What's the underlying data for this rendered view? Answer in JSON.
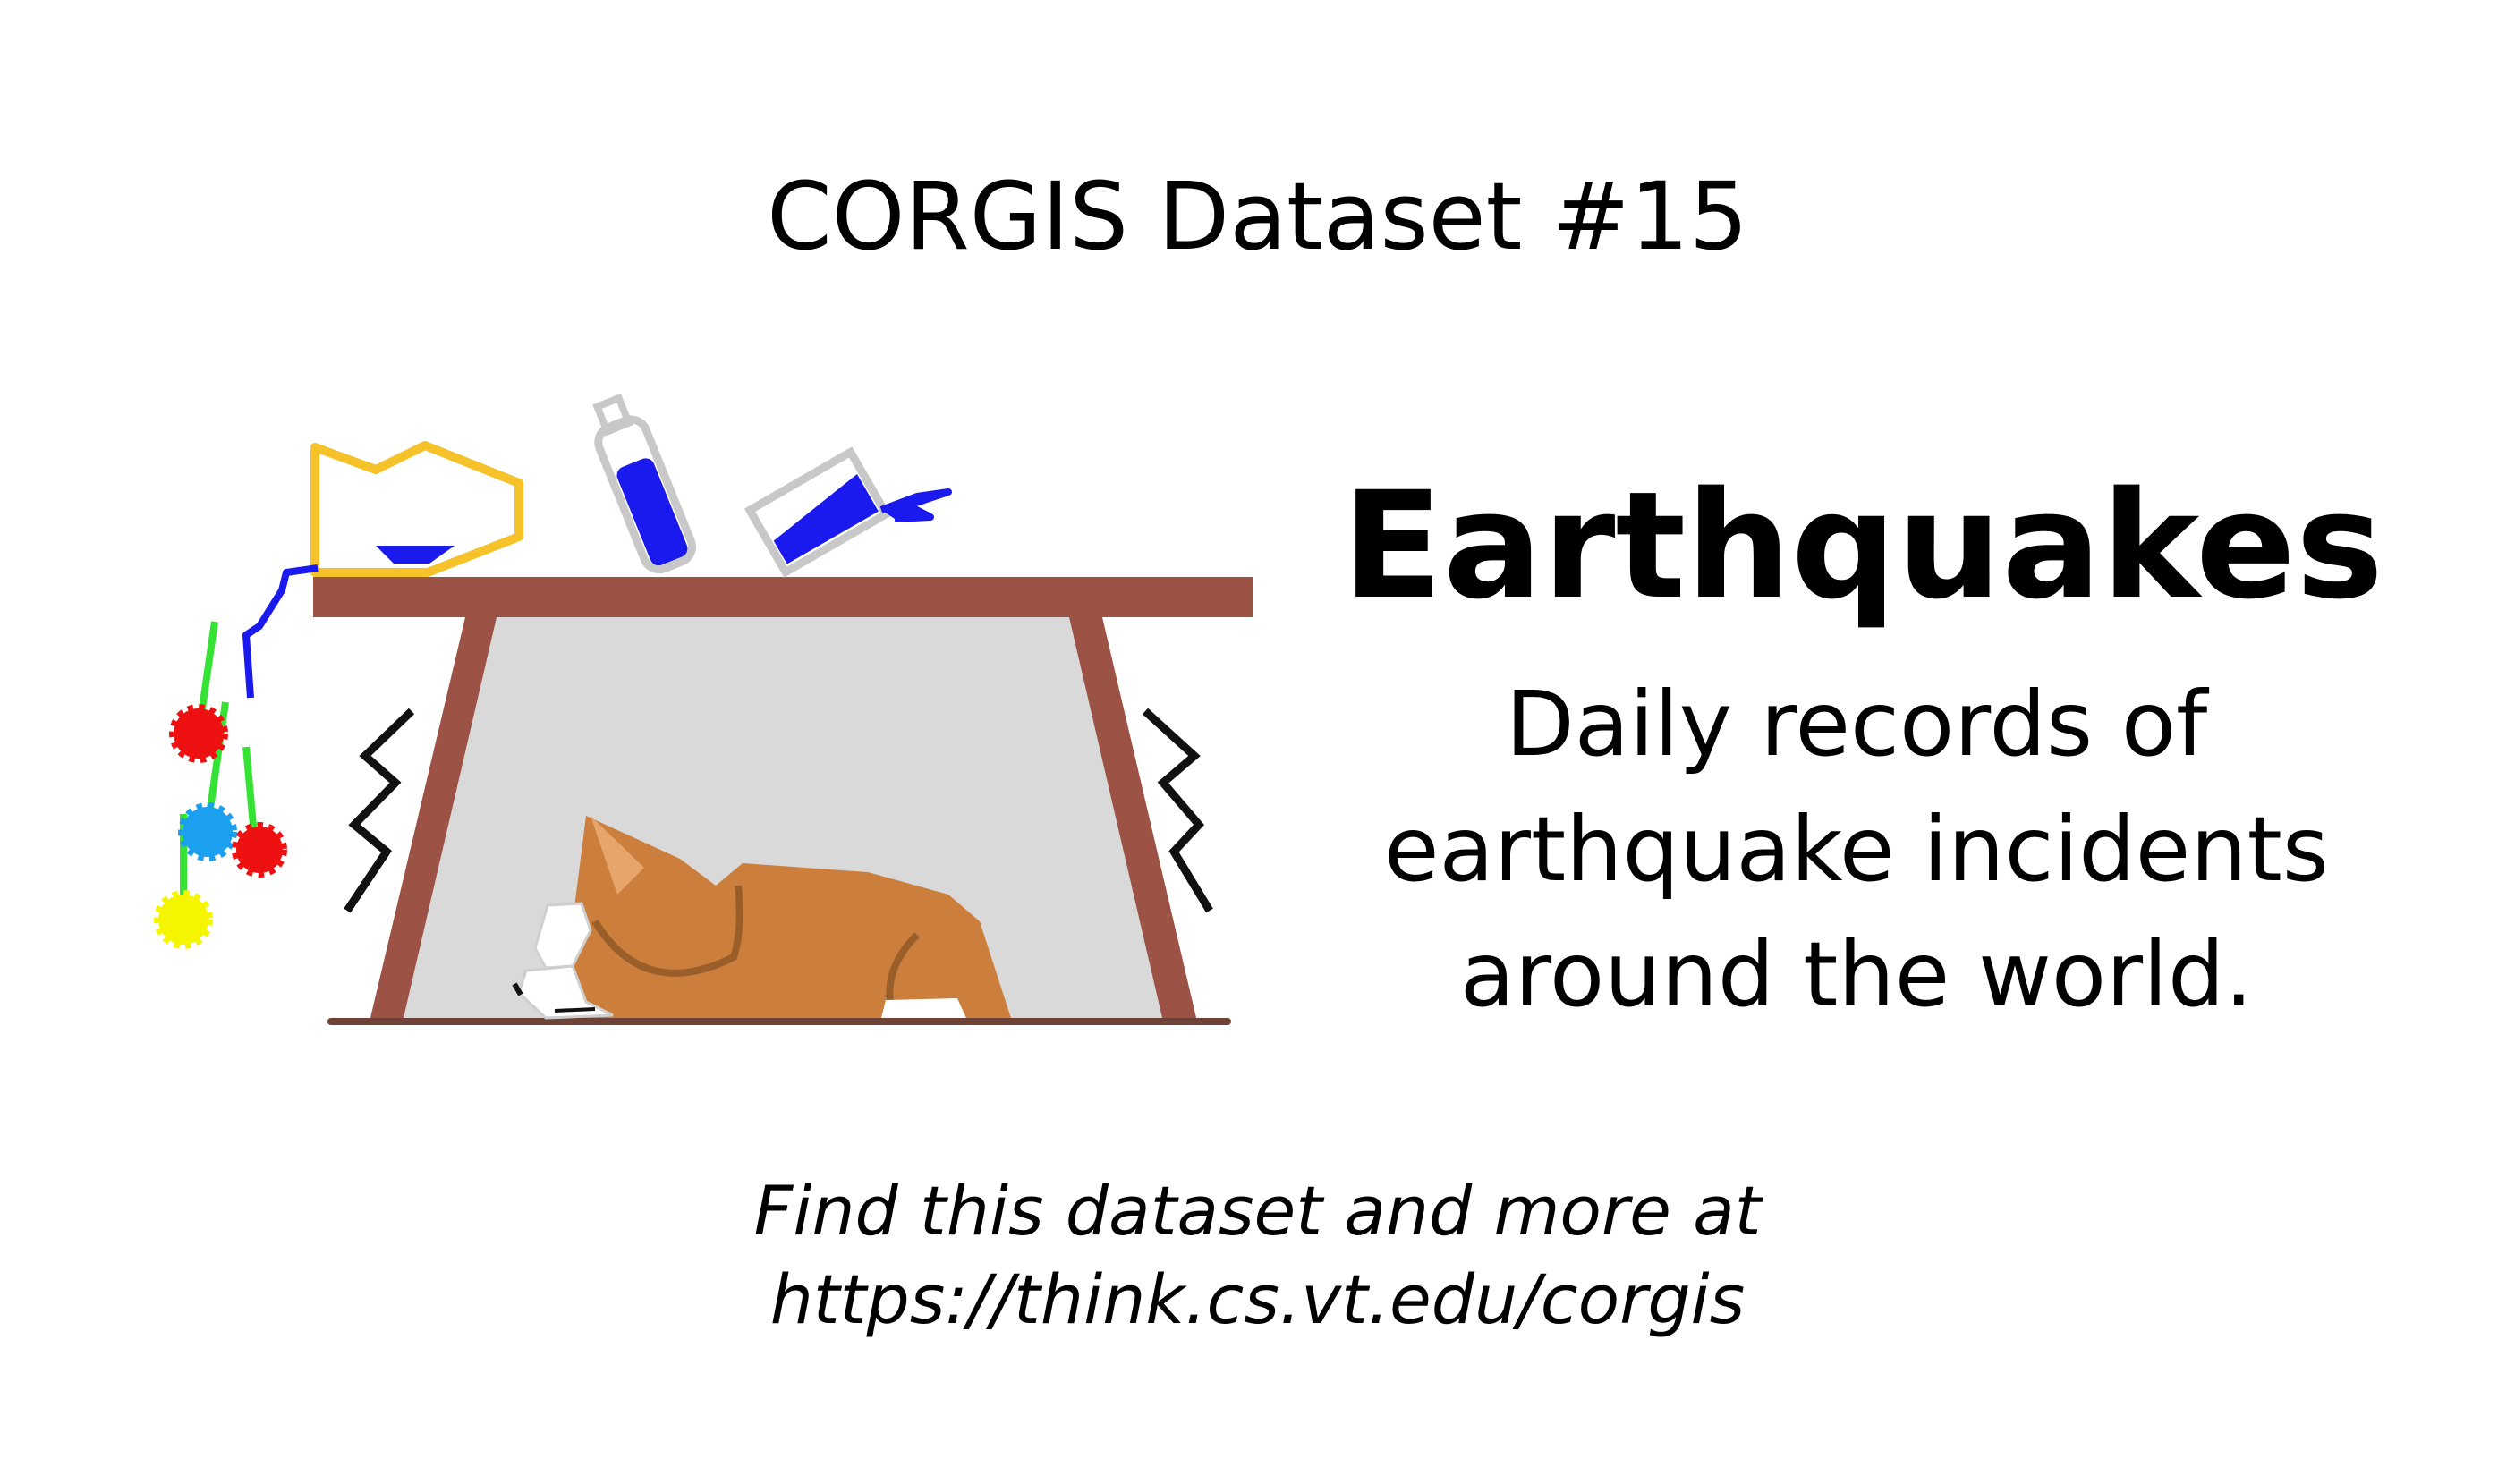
{
  "header": {
    "text": "CORGIS Dataset #15"
  },
  "main": {
    "title": "Earthquakes",
    "description": "Daily records of earthquake incidents around the world."
  },
  "footer": {
    "line1": "Find this dataset and more at",
    "line2": "https://think.cs.vt.edu/corgis"
  },
  "illustration": {
    "icon": "corgi-under-table-illustration",
    "colors": {
      "table": "#9c5345",
      "shelter": "#d9d9d9",
      "corgi": "#cc7f3c",
      "corgi_white": "#ffffff",
      "liquid": "#1a1aee",
      "vase": "#f5c22a",
      "bottle_outline": "#c8c8c8",
      "stems": "#35e335",
      "flower_red": "#ee1111",
      "flower_blue": "#1aa0ee",
      "flower_yellow": "#f5f500",
      "shake_lines": "#111111"
    }
  }
}
